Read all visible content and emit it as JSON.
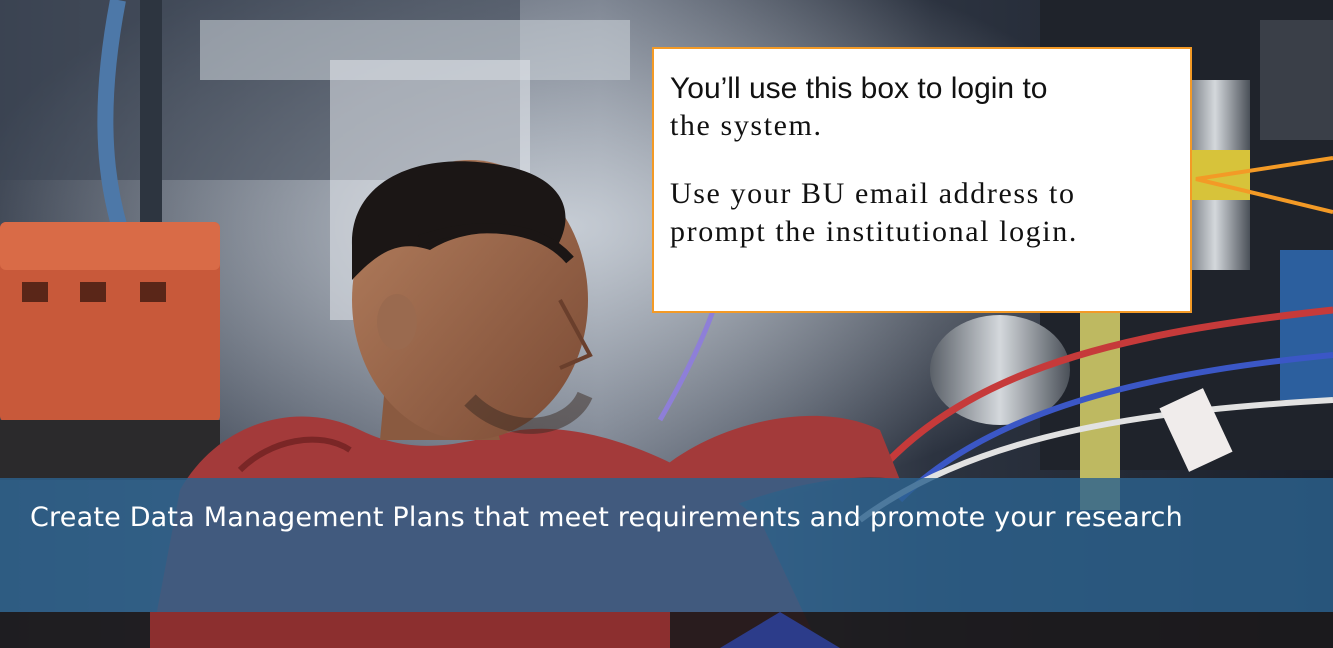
{
  "hero": {
    "caption": "Create Data Management Plans that meet requirements and promote your research"
  },
  "callout": {
    "line1": "You’ll use this box to login to",
    "line2": "the system.",
    "para2": "Use your BU email address to prompt the institutional login."
  },
  "colors": {
    "caption_band": "#2c628e",
    "callout_border": "#f39a26",
    "arrow": "#f39a26"
  }
}
